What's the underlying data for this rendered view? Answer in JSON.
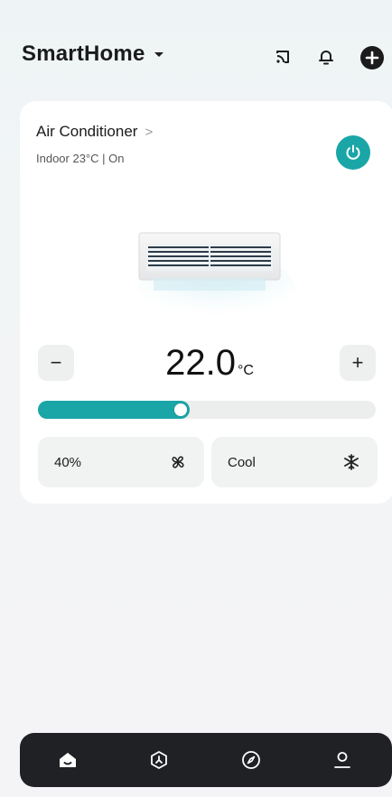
{
  "header": {
    "app_title": "SmartHome",
    "icons": [
      "cast-icon",
      "bell-icon",
      "add-icon"
    ]
  },
  "device": {
    "name": "Air Conditioner",
    "chevron": ">",
    "status": "Indoor 23°C | On",
    "power_icon": "power-icon",
    "accent_color": "#1aa5a7"
  },
  "temperature": {
    "value": "22.0",
    "unit": "°C",
    "decrease_label": "−",
    "increase_label": "+",
    "slider_fraction": 0.45
  },
  "modes": {
    "fan": {
      "label": "40%",
      "icon": "fan-icon"
    },
    "mode": {
      "label": "Cool",
      "icon": "snowflake-icon"
    }
  },
  "bottom_nav": {
    "items": [
      {
        "name": "home",
        "icon": "home-icon",
        "active": true
      },
      {
        "name": "automation",
        "icon": "automation-icon",
        "active": false
      },
      {
        "name": "discover",
        "icon": "compass-icon",
        "active": false
      },
      {
        "name": "profile",
        "icon": "user-icon",
        "active": false
      }
    ]
  }
}
